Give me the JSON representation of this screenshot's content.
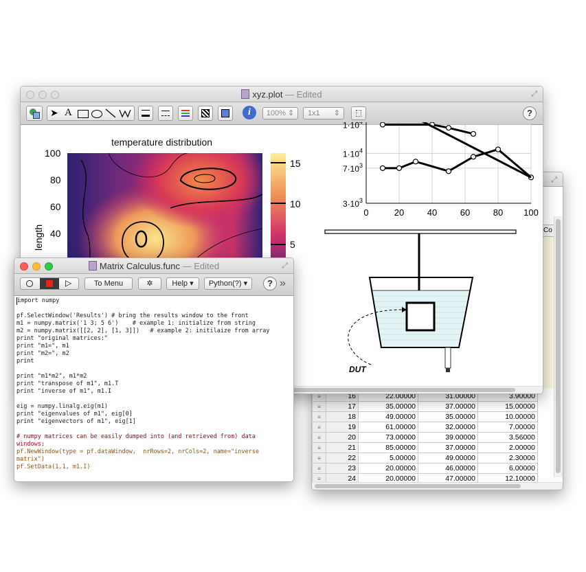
{
  "data_window": {
    "header_fragment": "Co",
    "rows": [
      {
        "n": "16",
        "a": "22.00000",
        "b": "31.00000",
        "c": "3.90000"
      },
      {
        "n": "17",
        "a": "35.00000",
        "b": "37.00000",
        "c": "15.00000"
      },
      {
        "n": "18",
        "a": "49.00000",
        "b": "35.00000",
        "c": "10.00000"
      },
      {
        "n": "19",
        "a": "61.00000",
        "b": "32.00000",
        "c": "7.00000"
      },
      {
        "n": "20",
        "a": "73.00000",
        "b": "39.00000",
        "c": "3.56000"
      },
      {
        "n": "21",
        "a": "85.00000",
        "b": "37.00000",
        "c": "2.00000"
      },
      {
        "n": "22",
        "a": "5.00000",
        "b": "49.00000",
        "c": "2.30000"
      },
      {
        "n": "23",
        "a": "20.00000",
        "b": "46.00000",
        "c": "6.00000"
      },
      {
        "n": "24",
        "a": "20.00000",
        "b": "47.00000",
        "c": "12.10000"
      }
    ]
  },
  "plot_window": {
    "title": "xyz.plot",
    "edited": "— Edited",
    "zoom": "100%",
    "grid": "1x1",
    "help": "?",
    "info": "i"
  },
  "heatmap": {
    "title": "temperature distribution",
    "ylabel": "length",
    "yticks": [
      "100",
      "80",
      "60",
      "40"
    ],
    "cbar_ticks": [
      "15",
      "10",
      "5"
    ],
    "colors": {
      "dark": "#1e1c6e",
      "mid": "#c0246a",
      "hot": "#f7e27c"
    }
  },
  "chart_data": {
    "type": "line",
    "x": [
      10,
      20,
      30,
      40,
      50,
      65,
      80,
      100
    ],
    "series": [
      {
        "values": [
          7000,
          7000,
          8200,
          null,
          6500,
          9200,
          11000,
          5600
        ]
      },
      {
        "values": [
          20000,
          null,
          null,
          20000,
          18500,
          16000,
          null,
          null
        ]
      }
    ],
    "xticks": [
      "0",
      "20",
      "40",
      "60",
      "80",
      "100"
    ],
    "yticks": [
      "3·10",
      "7·10",
      "1·10",
      "1·10"
    ],
    "yticks_exp": [
      "3",
      "3",
      "4",
      "4"
    ],
    "xlim": [
      0,
      100
    ],
    "yscale": "log",
    "grid": true
  },
  "diagram": {
    "label": "DUT"
  },
  "func_window": {
    "title": "Matrix Calculus.func",
    "edited": "— Edited",
    "to_menu": "To Menu",
    "help": "Help",
    "lang": "Python(?)",
    "help_q": "?",
    "more": "»",
    "code": [
      {
        "t": "import numpy",
        "c": "k"
      },
      {
        "t": "",
        "c": ""
      },
      {
        "t": "pf.SelectWindow('Results') # bring the results window to the front",
        "c": "k"
      },
      {
        "t": "m1 = numpy.matrix('1 3; 5 6')    # example 1: initialize from string",
        "c": "k"
      },
      {
        "t": "m2 = numpy.matrix([[2, 2], [1, 3]])   # example 2: initilaize from array",
        "c": "k"
      },
      {
        "t": "print \"original matrices:\"",
        "c": "k"
      },
      {
        "t": "print \"m1=\", m1",
        "c": "k"
      },
      {
        "t": "print \"m2=\", m2",
        "c": "k"
      },
      {
        "t": "print",
        "c": "k"
      },
      {
        "t": "",
        "c": ""
      },
      {
        "t": "print \"m1*m2\", m1*m2",
        "c": "k"
      },
      {
        "t": "print \"transpose of m1\", m1.T",
        "c": "k"
      },
      {
        "t": "print \"inverse of m1\", m1.I",
        "c": "k"
      },
      {
        "t": "",
        "c": ""
      },
      {
        "t": "eig = numpy.linalg.eig(m1)",
        "c": "k"
      },
      {
        "t": "print \"eigenvalues of m1\", eig[0]",
        "c": "k"
      },
      {
        "t": "print \"eigenvectors of m1\", eig[1]",
        "c": "k"
      },
      {
        "t": "",
        "c": ""
      },
      {
        "t": "# numpy matrices can be easily dumped into (and retrieved from) data",
        "c": "c"
      },
      {
        "t": "windows:",
        "c": "c"
      },
      {
        "t": "pf.NewWindow(type = pf.dataWindow,  nrRows=2, nrCols=2, name=\"inverse",
        "c": "f"
      },
      {
        "t": "matrix\")",
        "c": "f"
      },
      {
        "t": "pf.SetData(1,1, m1.I)",
        "c": "f"
      }
    ]
  }
}
